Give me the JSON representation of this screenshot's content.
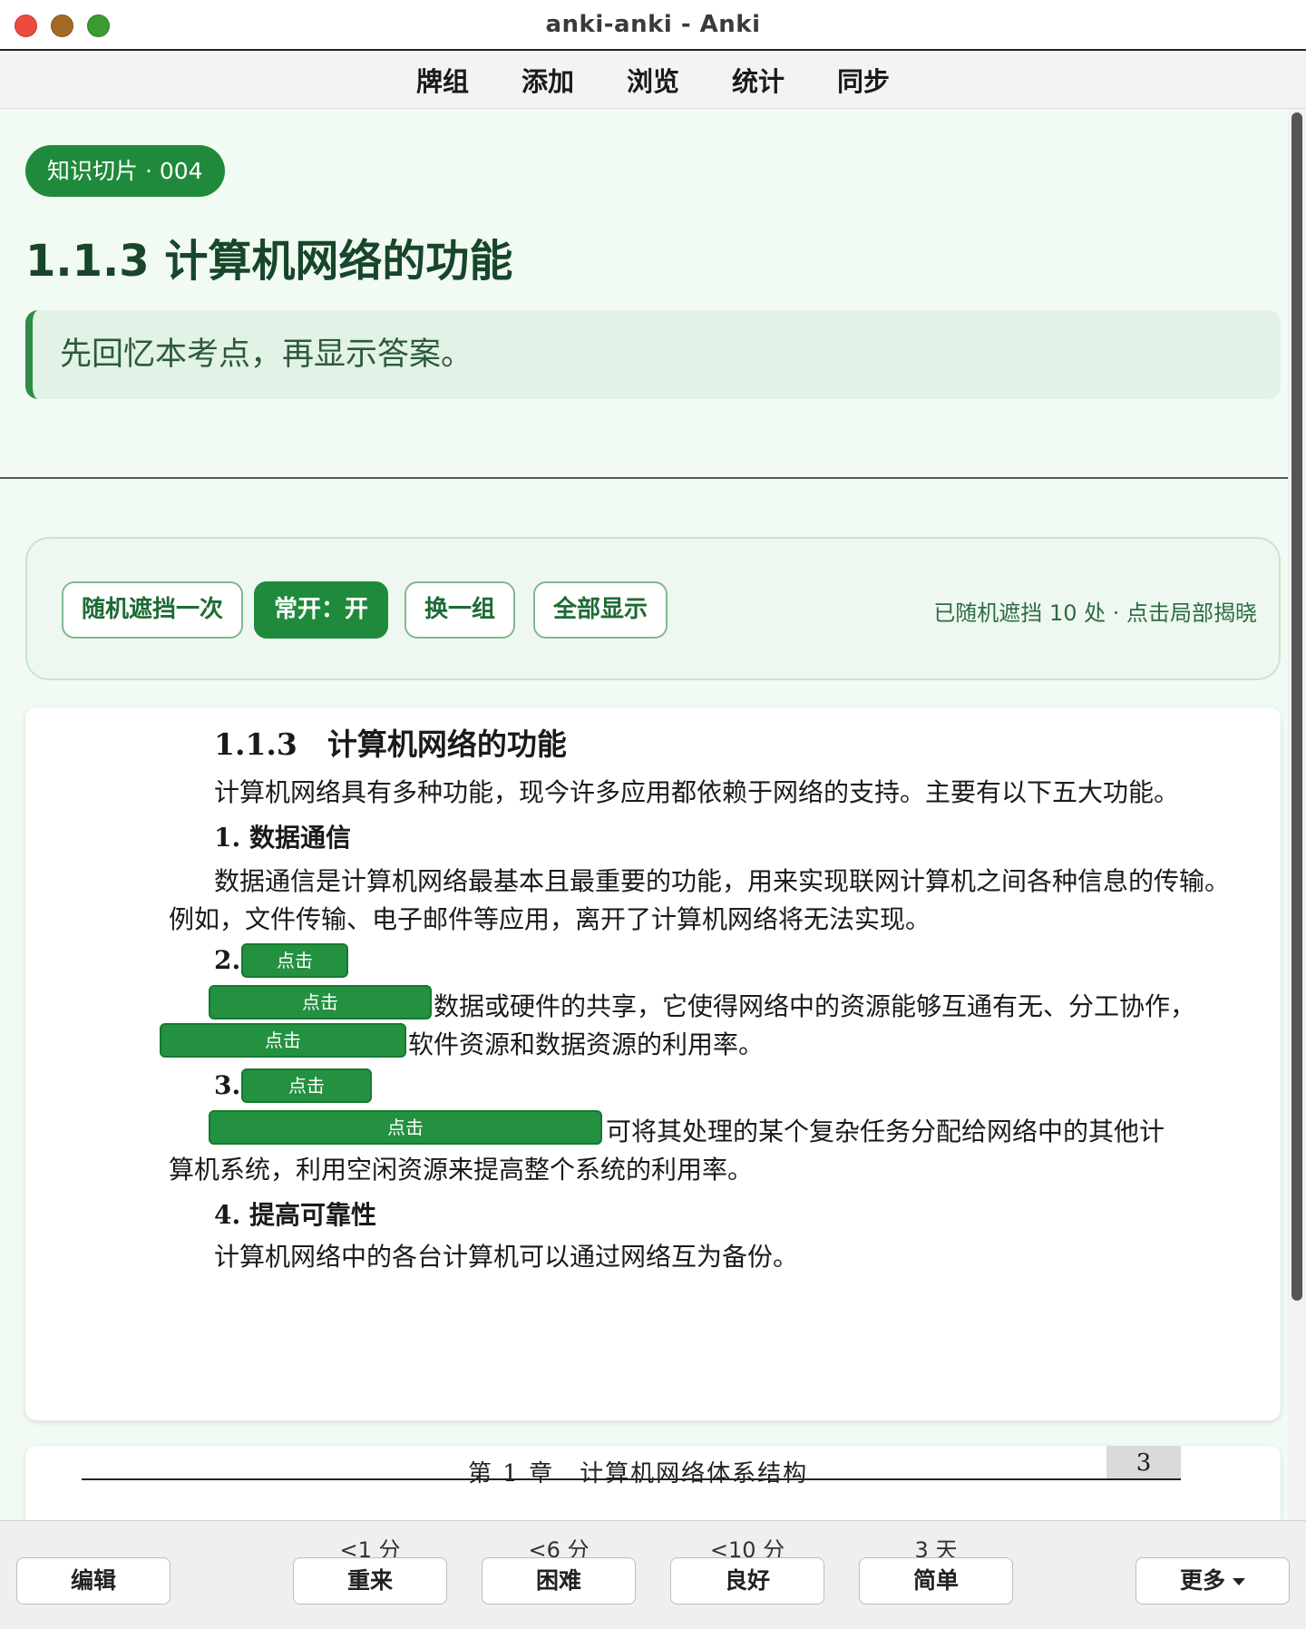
{
  "window": {
    "title": "anki-anki - Anki"
  },
  "topnav": [
    "牌组",
    "添加",
    "浏览",
    "统计",
    "同步"
  ],
  "question": {
    "chip": "知识切片 · 004",
    "title": "1.1.3 计算机网络的功能",
    "hint": "先回忆本考点，再显示答案。"
  },
  "controls": {
    "random_once": "随机遮挡一次",
    "always_on": "常开：开",
    "swap_group": "换一组",
    "show_all": "全部显示",
    "info": "已随机遮挡 10 处 · 点击局部揭晓"
  },
  "page": {
    "heading": "1.1.3　计算机网络的功能",
    "intro": "计算机网络具有多种功能，现今许多应用都依赖于网络的支持。主要有以下五大功能。",
    "s1_title": "1. 数据通信",
    "s1_p1": "数据通信是计算机网络最基本且最重要的功能，用来实现联网计算机之间各种信息的传输。",
    "s1_p2": "例如，文件传输、电子邮件等应用，离开了计算机网络将无法实现。",
    "s2_num": "2.",
    "s2_l1": "数据或硬件的共享，它使得网络中的资源能够互通有无、分工协作，",
    "s2_l2": "软件资源和数据资源的利用率。",
    "s3_num": "3.",
    "s3_l1": "可将其处理的某个复杂任务分配给网络中的其他计",
    "s3_l2": "算机系统，利用空闲资源来提高整个系统的利用率。",
    "s4_title": "4. 提高可靠性",
    "s4_p1": "计算机网络中的各台计算机可以通过网络互为备份。",
    "mask_label": "点击"
  },
  "page2": {
    "running_head": "第 1 章　计算机网络体系结构",
    "page_number": "3"
  },
  "bottom": {
    "edit": "编辑",
    "again": {
      "label": "重来",
      "interval": "<1 分"
    },
    "hard": {
      "label": "困难",
      "interval": "<6 分"
    },
    "good": {
      "label": "良好",
      "interval": "<10 分"
    },
    "easy": {
      "label": "简单",
      "interval": "3 天"
    },
    "more": "更多"
  }
}
